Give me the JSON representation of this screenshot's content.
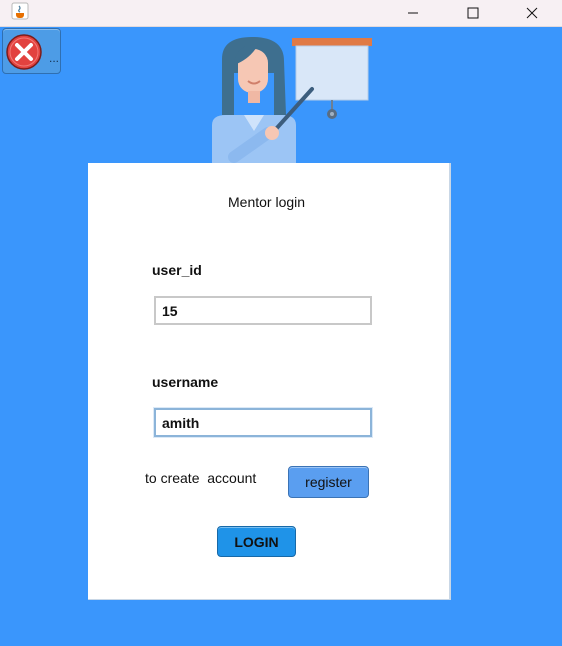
{
  "window": {
    "app_icon": "java-coffee-icon",
    "controls": [
      "minimize-icon",
      "maximize-icon",
      "close-icon"
    ]
  },
  "toolbar": {
    "exit_button_label": "...",
    "exit_icon": "red-x-circle-icon"
  },
  "illustration": "mentor-teaching-whiteboard",
  "form": {
    "title": "Mentor login",
    "user_id_label": "user_id",
    "user_id_value": "15",
    "username_label": "username",
    "username_value": "amith",
    "create_account_text": "to create  account",
    "register_label": "register",
    "login_label": "LOGIN"
  },
  "colors": {
    "background": "#3a96fc",
    "card": "#ffffff",
    "register_button": "#5a9ef0",
    "login_button": "#1f93e8",
    "exit_icon": "#e2423f"
  }
}
